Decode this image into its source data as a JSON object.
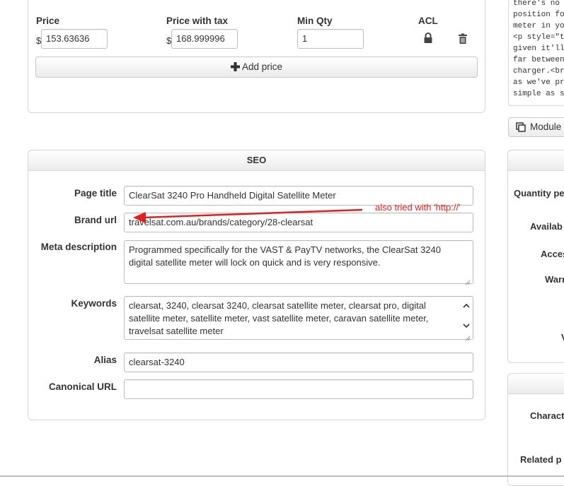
{
  "pricing": {
    "headers": {
      "price": "Price",
      "price_with_tax": "Price with tax",
      "min_qty": "Min Qty",
      "acl": "ACL"
    },
    "currency_symbol": "$",
    "row": {
      "price": "153.63636",
      "price_with_tax": "168.999996",
      "min_qty": "1"
    },
    "add_price_label": "Add price"
  },
  "seo": {
    "title": "SEO",
    "fields": {
      "page_title": {
        "label": "Page title",
        "value": "ClearSat 3240 Pro Handheld Digital Satellite Meter"
      },
      "brand_url": {
        "label": "Brand url",
        "value": "travelsat.com.au/brands/category/28-clearsat"
      },
      "meta_description": {
        "label": "Meta description",
        "value": "Programmed specifically for the VAST & PayTV networks, the ClearSat 3240 digital satellite meter will lock on quick and is very responsive."
      },
      "keywords": {
        "label": "Keywords",
        "value": "clearsat, 3240, clearsat 3240, clearsat satellite meter, clearsat pro, digital satellite meter, satellite meter, vast satellite meter, caravan satellite meter, travelsat satellite meter"
      },
      "alias": {
        "label": "Alias",
        "value": "clearsat-3240"
      },
      "canonical_url": {
        "label": "Canonical URL",
        "value": ""
      }
    }
  },
  "annotation": {
    "text": "also tried with 'http://'",
    "color": "#e02020"
  },
  "right_column": {
    "code_lines": [
      "there's no",
      "position fo",
      "meter in yo",
      "<p style=\"t",
      "given it'll",
      "far between",
      "charger.<br",
      "as we've pr",
      "simple as s"
    ],
    "module_button_label": "Module",
    "labels": [
      "Quantity pe",
      "Availab",
      "Acces",
      "Warr",
      "V",
      "Charact",
      "Related p"
    ]
  },
  "icons": {
    "lock": "lock-icon",
    "trash": "trash-icon",
    "plus": "plus-icon",
    "module": "copy-icon"
  }
}
